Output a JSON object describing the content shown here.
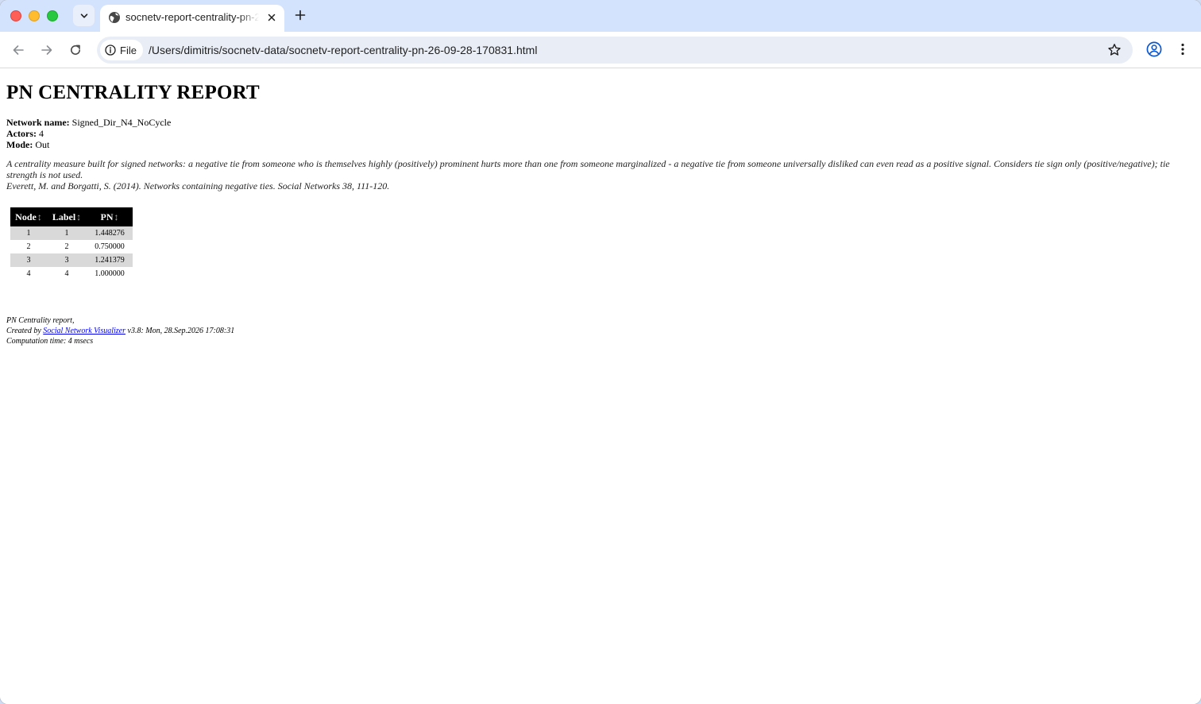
{
  "browser": {
    "tab": {
      "title": "socnetv-report-centrality-pn-26-09-28-170831.html"
    },
    "omnibox": {
      "scheme_label": "File",
      "url": "/Users/dimitris/socnetv-data/socnetv-report-centrality-pn-26-09-28-170831.html"
    }
  },
  "report": {
    "title": "PN CENTRALITY REPORT",
    "meta": [
      {
        "label": "Network name:",
        "value": "Signed_Dir_N4_NoCycle"
      },
      {
        "label": "Actors:",
        "value": "4"
      },
      {
        "label": "Mode:",
        "value": "Out"
      }
    ],
    "description": "A centrality measure built for signed networks: a negative tie from someone who is themselves highly (positively) prominent hurts more than one from someone marginalized - a negative tie from someone universally disliked can even read as a positive signal. Considers tie sign only (positive/negative); tie strength is not used.",
    "reference": "Everett, M. and Borgatti, S. (2014). Networks containing negative ties. Social Networks 38, 111-120.",
    "table": {
      "headers": [
        "Node",
        "Label",
        "PN"
      ],
      "sort_glyph": "↕",
      "rows": [
        [
          "1",
          "1",
          "1.448276"
        ],
        [
          "2",
          "2",
          "0.750000"
        ],
        [
          "3",
          "3",
          "1.241379"
        ],
        [
          "4",
          "4",
          "1.000000"
        ]
      ]
    },
    "footer": {
      "line1": "PN Centrality report,",
      "created_prefix": "Created by ",
      "link_text": "Social Network Visualizer",
      "created_suffix": " v3.8: Mon, 28.Sep.2026 17:08:31",
      "line3": "Computation time: 4 msecs"
    }
  }
}
